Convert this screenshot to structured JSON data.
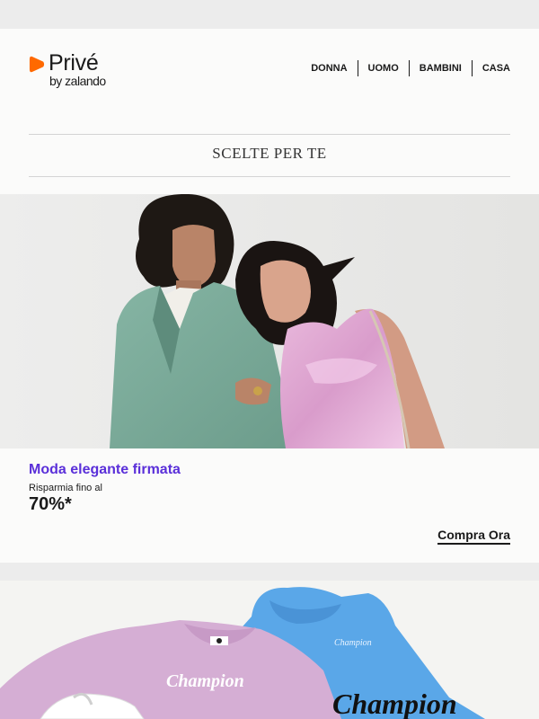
{
  "header": {
    "logo_text": "Privé",
    "logo_sub": "by zalando",
    "nav": [
      "DONNA",
      "UOMO",
      "BAMBINI",
      "CASA"
    ]
  },
  "section_title": "SCELTE PER TE",
  "promo": {
    "title": "Moda elegante firmata",
    "subtitle": "Risparmia fino al",
    "discount": "70%*",
    "cta": "Compra Ora"
  },
  "product_banner": {
    "brand": "Champion",
    "sweater_print": "Champion",
    "hoodie_print": "Champion"
  },
  "colors": {
    "brand_orange": "#ff6900",
    "promo_purple": "#5a2fd9"
  }
}
